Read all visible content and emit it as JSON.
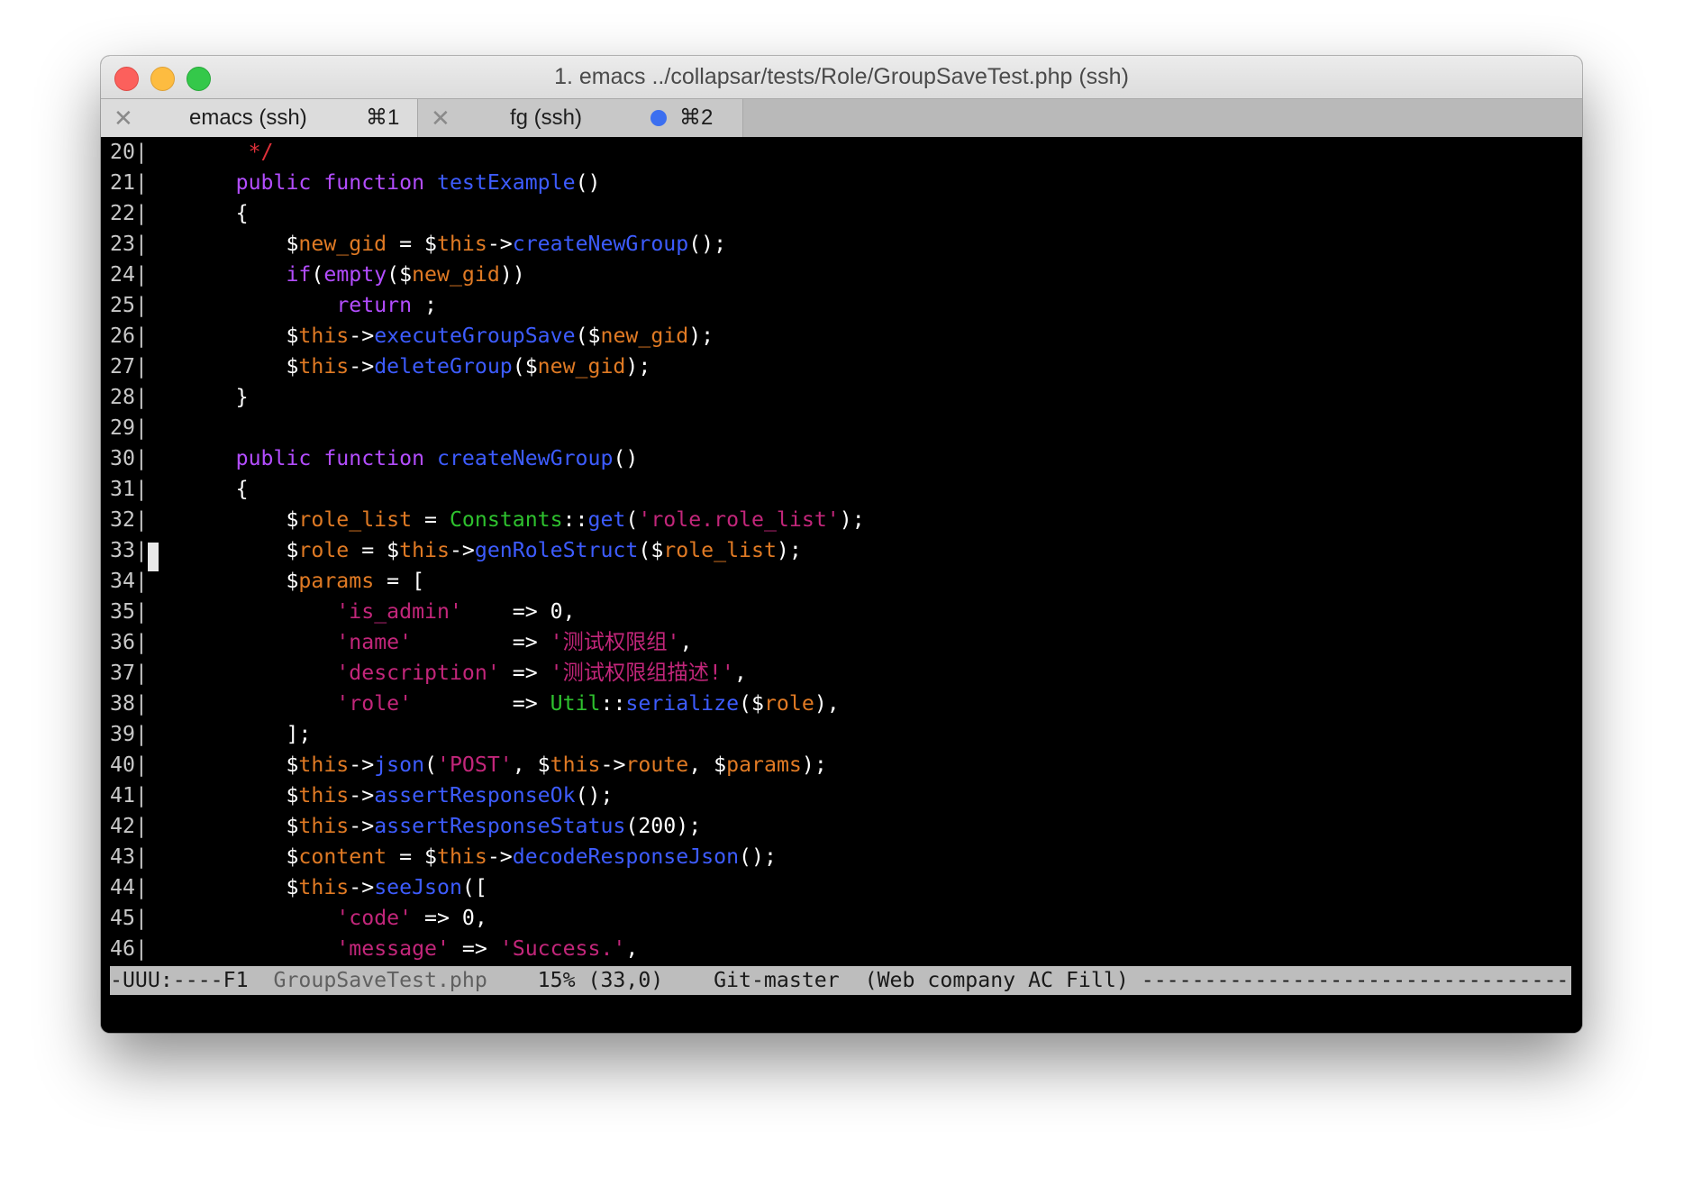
{
  "window": {
    "title": "1. emacs ../collapsar/tests/Role/GroupSaveTest.php (ssh)"
  },
  "tabs": [
    {
      "close": "✕",
      "label": "emacs (ssh)",
      "shortcut": "⌘1",
      "active": true
    },
    {
      "close": "✕",
      "label": "fg (ssh)",
      "shortcut": "⌘2",
      "active": false,
      "activity_dot": true
    }
  ],
  "colors": {
    "linenum": "#c8c8c8",
    "default": "#ffffff",
    "comment": "#e0303a",
    "keyword": "#b34dff",
    "method": "#3d5cff",
    "dollar": "#ffffff",
    "variable": "#e07a24",
    "string": "#c2267a",
    "class": "#2ec02e",
    "punct": "#ffffff",
    "number": "#ffffff"
  },
  "editor": {
    "lines": [
      {
        "num": "20|",
        "tokens": [
          [
            "default",
            "    "
          ],
          [
            "comment",
            " */"
          ]
        ]
      },
      {
        "num": "21|",
        "tokens": [
          [
            "default",
            "    "
          ],
          [
            "keyword",
            "public function "
          ],
          [
            "method",
            "testExample"
          ],
          [
            "default",
            "()"
          ]
        ]
      },
      {
        "num": "22|",
        "tokens": [
          [
            "default",
            "    {"
          ]
        ]
      },
      {
        "num": "23|",
        "tokens": [
          [
            "default",
            "        $"
          ],
          [
            "variable",
            "new_gid"
          ],
          [
            "default",
            " = $"
          ],
          [
            "variable",
            "this"
          ],
          [
            "default",
            "->"
          ],
          [
            "method",
            "createNewGroup"
          ],
          [
            "default",
            "();"
          ]
        ]
      },
      {
        "num": "24|",
        "tokens": [
          [
            "default",
            "        "
          ],
          [
            "keyword",
            "if"
          ],
          [
            "default",
            "("
          ],
          [
            "keyword",
            "empty"
          ],
          [
            "default",
            "($"
          ],
          [
            "variable",
            "new_gid"
          ],
          [
            "default",
            "))"
          ]
        ]
      },
      {
        "num": "25|",
        "tokens": [
          [
            "default",
            "            "
          ],
          [
            "keyword",
            "return"
          ],
          [
            "default",
            " ;"
          ]
        ]
      },
      {
        "num": "26|",
        "tokens": [
          [
            "default",
            "        $"
          ],
          [
            "variable",
            "this"
          ],
          [
            "default",
            "->"
          ],
          [
            "method",
            "executeGroupSave"
          ],
          [
            "default",
            "($"
          ],
          [
            "variable",
            "new_gid"
          ],
          [
            "default",
            ");"
          ]
        ]
      },
      {
        "num": "27|",
        "tokens": [
          [
            "default",
            "        $"
          ],
          [
            "variable",
            "this"
          ],
          [
            "default",
            "->"
          ],
          [
            "method",
            "deleteGroup"
          ],
          [
            "default",
            "($"
          ],
          [
            "variable",
            "new_gid"
          ],
          [
            "default",
            ");"
          ]
        ]
      },
      {
        "num": "28|",
        "tokens": [
          [
            "default",
            "    }"
          ]
        ]
      },
      {
        "num": "29|",
        "tokens": []
      },
      {
        "num": "30|",
        "tokens": [
          [
            "default",
            "    "
          ],
          [
            "keyword",
            "public function "
          ],
          [
            "method",
            "createNewGroup"
          ],
          [
            "default",
            "()"
          ]
        ]
      },
      {
        "num": "31|",
        "tokens": [
          [
            "default",
            "    {"
          ]
        ]
      },
      {
        "num": "32|",
        "tokens": [
          [
            "default",
            "        $"
          ],
          [
            "variable",
            "role_list"
          ],
          [
            "default",
            " = "
          ],
          [
            "class",
            "Constants"
          ],
          [
            "default",
            "::"
          ],
          [
            "method",
            "get"
          ],
          [
            "default",
            "("
          ],
          [
            "string",
            "'role.role_list'"
          ],
          [
            "default",
            ");"
          ]
        ]
      },
      {
        "num": "33|",
        "tokens": [
          [
            "default",
            "        $"
          ],
          [
            "variable",
            "role"
          ],
          [
            "default",
            " = $"
          ],
          [
            "variable",
            "this"
          ],
          [
            "default",
            "->"
          ],
          [
            "method",
            "genRoleStruct"
          ],
          [
            "default",
            "($"
          ],
          [
            "variable",
            "role_list"
          ],
          [
            "default",
            ");"
          ]
        ]
      },
      {
        "num": "34|",
        "tokens": [
          [
            "default",
            "        $"
          ],
          [
            "variable",
            "params"
          ],
          [
            "default",
            " = ["
          ]
        ]
      },
      {
        "num": "35|",
        "tokens": [
          [
            "default",
            "            "
          ],
          [
            "string",
            "'is_admin'"
          ],
          [
            "default",
            "    => 0,"
          ]
        ]
      },
      {
        "num": "36|",
        "tokens": [
          [
            "default",
            "            "
          ],
          [
            "string",
            "'name'"
          ],
          [
            "default",
            "        => "
          ],
          [
            "string",
            "'测试权限组'"
          ],
          [
            "default",
            ","
          ]
        ]
      },
      {
        "num": "37|",
        "tokens": [
          [
            "default",
            "            "
          ],
          [
            "string",
            "'description'"
          ],
          [
            "default",
            " => "
          ],
          [
            "string",
            "'测试权限组描述!'"
          ],
          [
            "default",
            ","
          ]
        ]
      },
      {
        "num": "38|",
        "tokens": [
          [
            "default",
            "            "
          ],
          [
            "string",
            "'role'"
          ],
          [
            "default",
            "        => "
          ],
          [
            "class",
            "Util"
          ],
          [
            "default",
            "::"
          ],
          [
            "method",
            "serialize"
          ],
          [
            "default",
            "($"
          ],
          [
            "variable",
            "role"
          ],
          [
            "default",
            "),"
          ]
        ]
      },
      {
        "num": "39|",
        "tokens": [
          [
            "default",
            "        ];"
          ]
        ]
      },
      {
        "num": "40|",
        "tokens": [
          [
            "default",
            "        $"
          ],
          [
            "variable",
            "this"
          ],
          [
            "default",
            "->"
          ],
          [
            "method",
            "json"
          ],
          [
            "default",
            "("
          ],
          [
            "string",
            "'POST'"
          ],
          [
            "default",
            ", $"
          ],
          [
            "variable",
            "this"
          ],
          [
            "default",
            "->"
          ],
          [
            "variable",
            "route"
          ],
          [
            "default",
            ", $"
          ],
          [
            "variable",
            "params"
          ],
          [
            "default",
            ");"
          ]
        ]
      },
      {
        "num": "41|",
        "tokens": [
          [
            "default",
            "        $"
          ],
          [
            "variable",
            "this"
          ],
          [
            "default",
            "->"
          ],
          [
            "method",
            "assertResponseOk"
          ],
          [
            "default",
            "();"
          ]
        ]
      },
      {
        "num": "42|",
        "tokens": [
          [
            "default",
            "        $"
          ],
          [
            "variable",
            "this"
          ],
          [
            "default",
            "->"
          ],
          [
            "method",
            "assertResponseStatus"
          ],
          [
            "default",
            "(200);"
          ]
        ]
      },
      {
        "num": "43|",
        "tokens": [
          [
            "default",
            "        $"
          ],
          [
            "variable",
            "content"
          ],
          [
            "default",
            " = $"
          ],
          [
            "variable",
            "this"
          ],
          [
            "default",
            "->"
          ],
          [
            "method",
            "decodeResponseJson"
          ],
          [
            "default",
            "();"
          ]
        ]
      },
      {
        "num": "44|",
        "tokens": [
          [
            "default",
            "        $"
          ],
          [
            "variable",
            "this"
          ],
          [
            "default",
            "->"
          ],
          [
            "method",
            "seeJson"
          ],
          [
            "default",
            "(["
          ]
        ]
      },
      {
        "num": "45|",
        "tokens": [
          [
            "default",
            "            "
          ],
          [
            "string",
            "'code'"
          ],
          [
            "default",
            " => 0,"
          ]
        ]
      },
      {
        "num": "46|",
        "tokens": [
          [
            "default",
            "            "
          ],
          [
            "string",
            "'message'"
          ],
          [
            "default",
            " => "
          ],
          [
            "string",
            "'Success.'"
          ],
          [
            "default",
            ","
          ]
        ]
      }
    ],
    "cursor_line": "33"
  },
  "modeline": {
    "status": "-UUU:----F1  ",
    "buffer": "GroupSaveTest.php",
    "position": "    15% (33,0)    Git-master  (Web company AC Fill) ",
    "fill": "------------------------------------------------------------"
  }
}
